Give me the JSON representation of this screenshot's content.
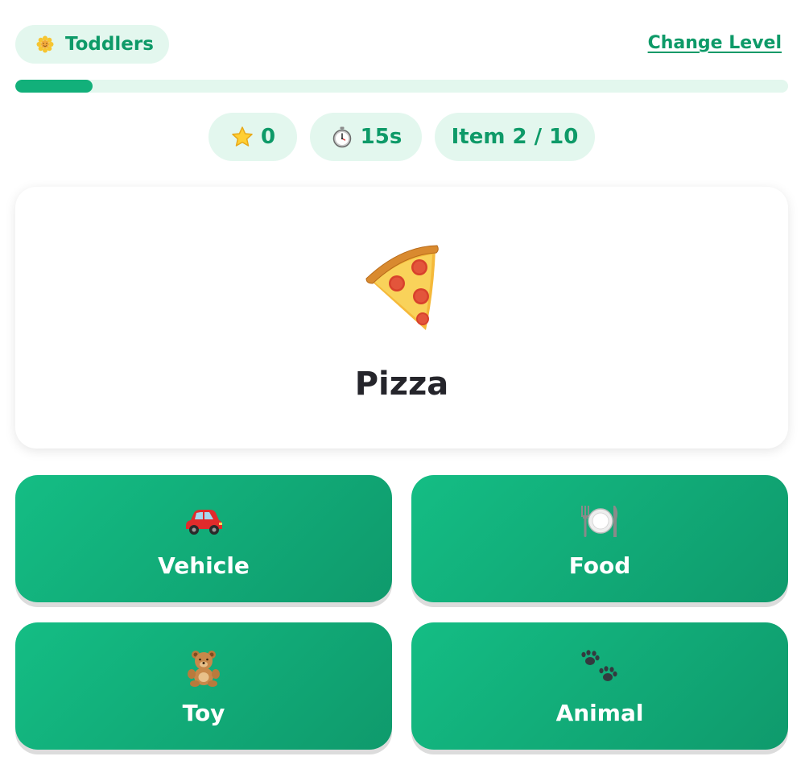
{
  "header": {
    "level_label": "Toddlers",
    "level_icon": "sun-flower-icon",
    "change_level_label": "Change Level"
  },
  "progress": {
    "fraction": 0.1,
    "fill_color": "#12b07a",
    "track_color": "#e3f7ee"
  },
  "stats": {
    "score": "0",
    "score_icon": "star-icon",
    "time": "15s",
    "time_icon": "stopwatch-icon",
    "item_progress": "Item 2 / 10"
  },
  "current_item": {
    "name": "Pizza",
    "icon": "pizza-icon"
  },
  "choices": [
    {
      "label": "Vehicle",
      "icon": "car-icon"
    },
    {
      "label": "Food",
      "icon": "plate-cutlery-icon"
    },
    {
      "label": "Toy",
      "icon": "teddy-bear-icon"
    },
    {
      "label": "Animal",
      "icon": "paw-prints-icon"
    }
  ],
  "colors": {
    "accent": "#0e9a68",
    "chip_background": "#e3f7ee",
    "button_gradient_start": "#14bd84",
    "button_gradient_end": "#0f9a6c",
    "item_text": "#25252b"
  }
}
